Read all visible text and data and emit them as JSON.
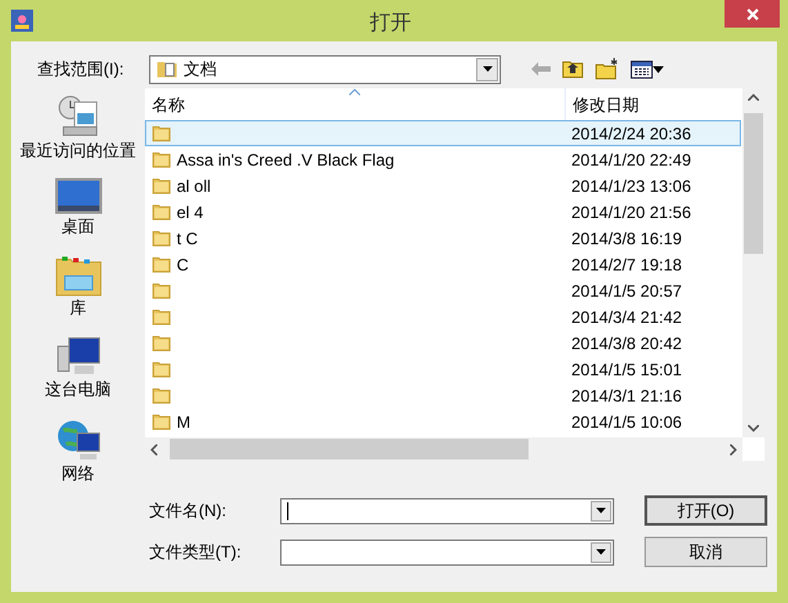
{
  "window": {
    "title": "打开"
  },
  "look_in": {
    "label": "查找范围(I):",
    "value": "文档"
  },
  "places": [
    {
      "label": "最近访问的位置",
      "kind": "recent"
    },
    {
      "label": "桌面",
      "kind": "desktop"
    },
    {
      "label": "库",
      "kind": "library"
    },
    {
      "label": "这台电脑",
      "kind": "computer"
    },
    {
      "label": "网络",
      "kind": "network"
    }
  ],
  "table": {
    "columns": [
      "名称",
      "修改日期"
    ],
    "rows": [
      {
        "date": "2014/2/24 20:36",
        "selected": true
      },
      {
        "name": "Assa  in's Creed .V Black Flag",
        "date": "2014/1/20 22:49",
        "selected": false
      },
      {
        "name": "al  oll",
        "date": "2014/1/23 13:06",
        "selected": false
      },
      {
        "name": "el  4",
        "date": "2014/1/20 21:56",
        "selected": false
      },
      {
        "name": "t  C",
        "date": "2014/3/8 16:19",
        "selected": false
      },
      {
        "name": "C",
        "date": "2014/2/7 19:18",
        "selected": false
      },
      {
        "date": "2014/1/5 20:57",
        "selected": false
      },
      {
        "date": "2014/3/4 21:42",
        "selected": false
      },
      {
        "date": "2014/3/8 20:42",
        "selected": false
      },
      {
        "date": "2014/1/5 15:01",
        "selected": false
      },
      {
        "date": "2014/3/1 21:16",
        "selected": false
      },
      {
        "name": "M",
        "date": "2014/1/5 10:06",
        "selected": false
      }
    ]
  },
  "file_name": {
    "label": "文件名(N):"
  },
  "file_type": {
    "label": "文件类型(T):"
  },
  "buttons": [
    "打开(O)",
    "取消"
  ]
}
